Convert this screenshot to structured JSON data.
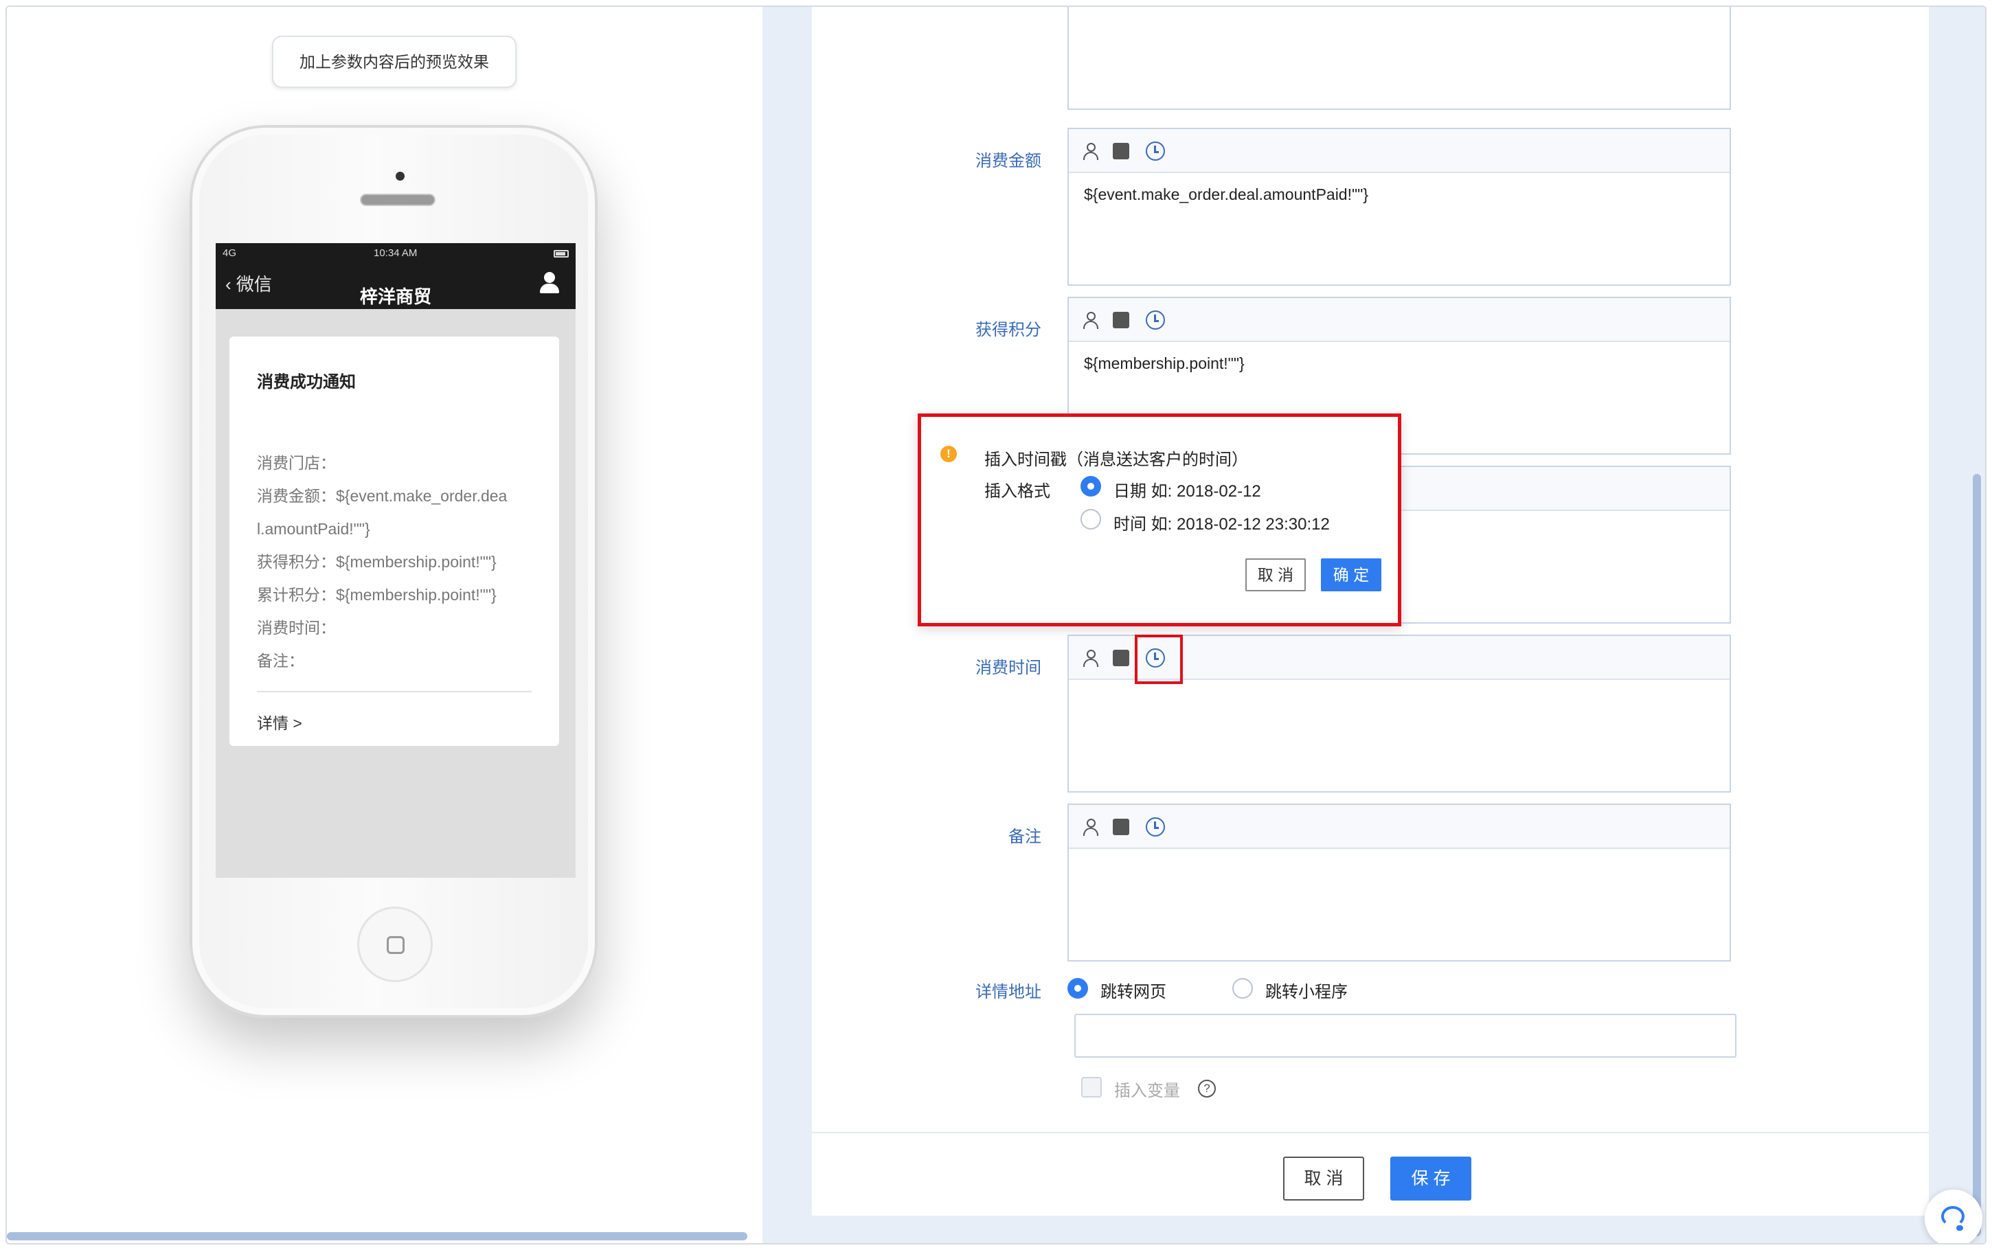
{
  "preview": {
    "tip": "加上参数内容后的预览效果",
    "phone": {
      "status_signal": "4G",
      "status_time": "10:34 AM",
      "back_label": "微信",
      "title": "梓洋商贸"
    },
    "message": {
      "title": "消费成功通知",
      "lines": [
        "消费门店：",
        "消费金额：${event.make_order.dea",
        "l.amountPaid!\"\"}",
        "获得积分：${membership.point!\"\"}",
        "累计积分：${membership.point!\"\"}",
        "消费时间：",
        "备注："
      ],
      "detail": "详情 >"
    }
  },
  "form": {
    "fields": [
      {
        "label": "消费金额",
        "value": "${event.make_order.deal.amountPaid!\"\"}"
      },
      {
        "label": "获得积分",
        "value": "${membership.point!\"\"}"
      },
      {
        "label": "",
        "value": ""
      },
      {
        "label": "消费时间",
        "value": ""
      },
      {
        "label": "备注",
        "value": ""
      }
    ],
    "detail_url": {
      "label": "详情地址",
      "option_web": "跳转网页",
      "option_miniapp": "跳转小程序",
      "selected": "跳转网页",
      "value": ""
    },
    "insert_variable": "插入变量",
    "cancel": "取 消",
    "save": "保 存"
  },
  "popover": {
    "title": "插入时间戳（消息送达客户的时间）",
    "format_label": "插入格式",
    "options": [
      "日期 如: 2018-02-12",
      "时间 如: 2018-02-12 23:30:12"
    ],
    "selected": 0,
    "cancel": "取 消",
    "confirm": "确 定"
  },
  "colors": {
    "accent": "#2f7cf0",
    "label_blue": "#3a6bb5",
    "highlight": "#e0101a",
    "warning": "#f5a623"
  }
}
